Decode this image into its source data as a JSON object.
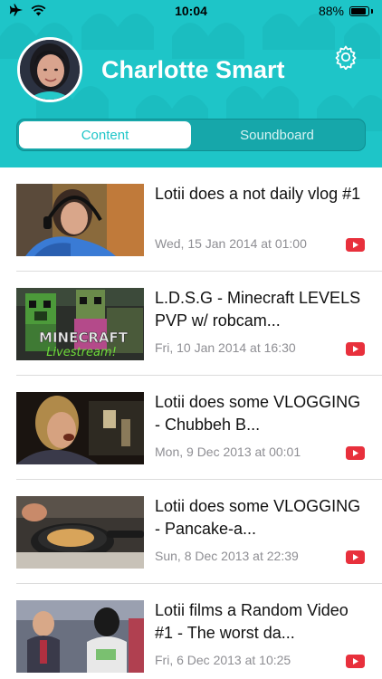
{
  "status_bar": {
    "time": "10:04",
    "battery": "88%",
    "battery_level": 0.88,
    "icons": [
      "airplane-icon",
      "wifi-icon",
      "battery-icon"
    ]
  },
  "profile": {
    "name": "Charlotte Smart"
  },
  "tabs": [
    {
      "label": "Content",
      "selected": true
    },
    {
      "label": "Soundboard",
      "selected": false
    }
  ],
  "videos": [
    {
      "title": "Lotii does a not daily vlog #1",
      "date": "Wed, 15 Jan 2014 at 01:00"
    },
    {
      "title": "L.D.S.G - Minecraft LEVELS PVP w/ robcam...",
      "date": "Fri, 10 Jan 2014 at 16:30"
    },
    {
      "title": "Lotii does some VLOGGING - Chubbeh B...",
      "date": "Mon, 9 Dec 2013 at 00:01"
    },
    {
      "title": "Lotii does some VLOGGING - Pancake-a...",
      "date": "Sun, 8 Dec 2013 at 22:39"
    },
    {
      "title": "Lotii films a Random Video #1 - The worst da...",
      "date": "Fri, 6 Dec 2013 at 10:25"
    }
  ],
  "thumbnail_text": {
    "minecraft": "MINECRAFT",
    "livestream": "Livestream!"
  },
  "colors": {
    "accent": "#1ec5c8",
    "youtube_red": "#e8303c",
    "date_gray": "#8e8e93"
  }
}
